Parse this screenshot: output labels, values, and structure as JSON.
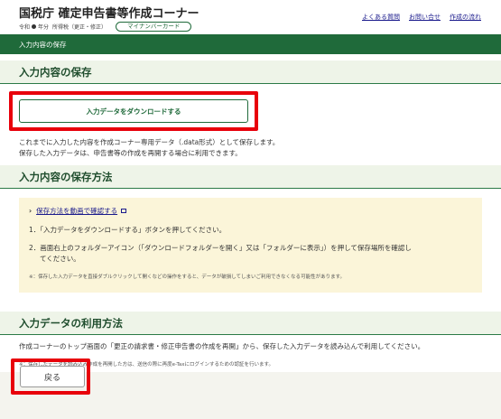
{
  "header": {
    "title": "国税庁 確定申告書等作成コーナー",
    "era": "令和",
    "year_suffix": "年分",
    "tax_type": "所得税（更正・修正）",
    "mynumber_label": "マイナンバーカード",
    "links": [
      "よくある質問",
      "お問い合せ",
      "作成の流れ"
    ]
  },
  "breadcrumb": {
    "current": "入力内容の保存"
  },
  "section1": {
    "title": "入力内容の保存",
    "download_button": "入力データをダウンロードする",
    "desc_line1": "これまでに入力した内容を作成コーナー専用データ（.data形式）として保存します。",
    "desc_line2": "保存した入力データは、申告書等の作成を再開する場合に利用できます。"
  },
  "section2": {
    "title": "入力内容の保存方法",
    "video_link": "保存方法を動画で確認する",
    "step1": "1．「入力データをダウンロードする」ボタンを押してください。",
    "step2_line1": "2．画面右上のフォルダーアイコン（「ダウンロードフォルダーを開く」又は「フォルダーに表示」）を押して保存場所を確認し",
    "step2_line2": "てください。",
    "note": "※：保存した入力データを直接ダブルクリックして開くなどの操作をすると、データが破損してしまいご利用できなくなる可能性があります。"
  },
  "section3": {
    "title": "入力データの利用方法",
    "desc": "作成コーナーのトップ画面の「更正の請求書・修正申告書の作成を再開」から、保存した入力データを読み込んで利用してください。",
    "note": "※：保存したデータを読み込み作成を再開した方は、送信の際に再度e-Taxにログインするための認証を行います。"
  },
  "footer": {
    "back_button": "戻る"
  },
  "colors": {
    "brand_green": "#1f6a3a",
    "highlight_red": "#e8000b",
    "panel_yellow": "#fbf5d9",
    "link_blue": "#1a1a8c"
  }
}
